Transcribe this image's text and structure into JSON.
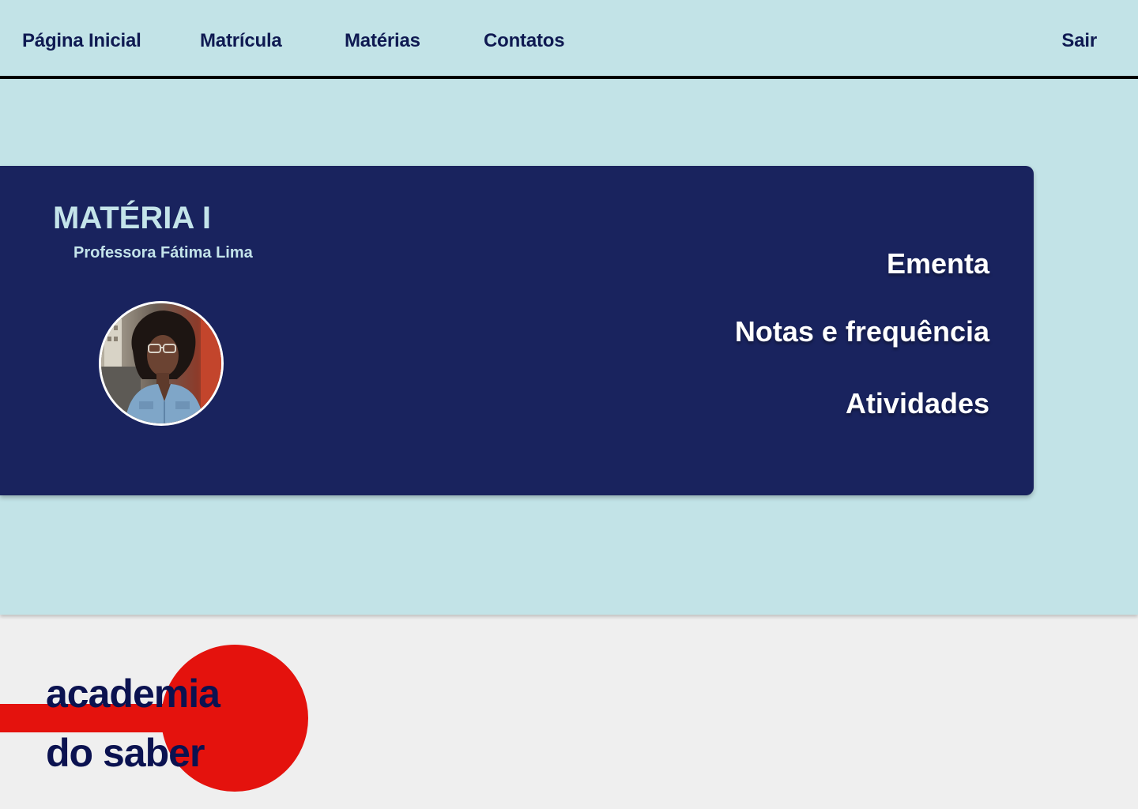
{
  "nav": {
    "home": "Página Inicial",
    "enroll": "Matrícula",
    "subjects": "Matérias",
    "contacts": "Contatos",
    "logout": "Sair"
  },
  "course": {
    "title": "MATÉRIA I",
    "teacher": "Professora Fátima Lima",
    "links": {
      "syllabus": "Ementa",
      "grades": "Notas e frequência",
      "activities": "Atividades"
    }
  },
  "brand": {
    "line1": "academia",
    "line2": "do saber",
    "logo_wordmark": "academia do saber",
    "accent_color": "#e4120d",
    "navy_color": "#19235e",
    "background_color": "#c2e3e7"
  },
  "icons": {
    "teacher_photo": "teacher-photo-avatar"
  }
}
